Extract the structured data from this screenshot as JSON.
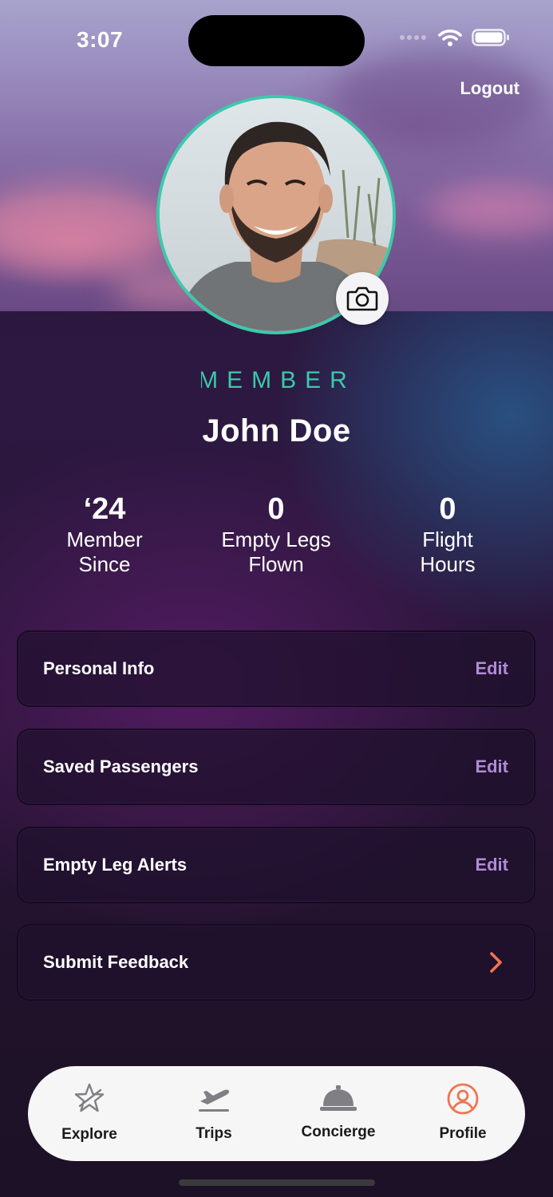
{
  "status_bar": {
    "time": "3:07"
  },
  "header": {
    "logout_label": "Logout"
  },
  "profile": {
    "badge": "MEMBER",
    "name": "John Doe"
  },
  "stats": [
    {
      "value": "‘24",
      "label_line1": "Member",
      "label_line2": "Since"
    },
    {
      "value": "0",
      "label_line1": "Empty Legs",
      "label_line2": "Flown"
    },
    {
      "value": "0",
      "label_line1": "Flight",
      "label_line2": "Hours"
    }
  ],
  "menu": [
    {
      "title": "Personal Info",
      "action": "Edit"
    },
    {
      "title": "Saved Passengers",
      "action": "Edit"
    },
    {
      "title": "Empty Leg Alerts",
      "action": "Edit"
    },
    {
      "title": "Submit Feedback",
      "action_icon": "chevron-right-icon"
    }
  ],
  "tab_bar": {
    "items": [
      {
        "label": "Explore",
        "icon": "star-plane-icon"
      },
      {
        "label": "Trips",
        "icon": "airplane-departure-icon"
      },
      {
        "label": "Concierge",
        "icon": "service-bell-icon"
      },
      {
        "label": "Profile",
        "icon": "user-circle-icon",
        "active": true
      }
    ]
  },
  "colors": {
    "accent_teal": "#3cc9aa",
    "edit_purple": "#b08bd6",
    "active_orange": "#f0744f"
  }
}
